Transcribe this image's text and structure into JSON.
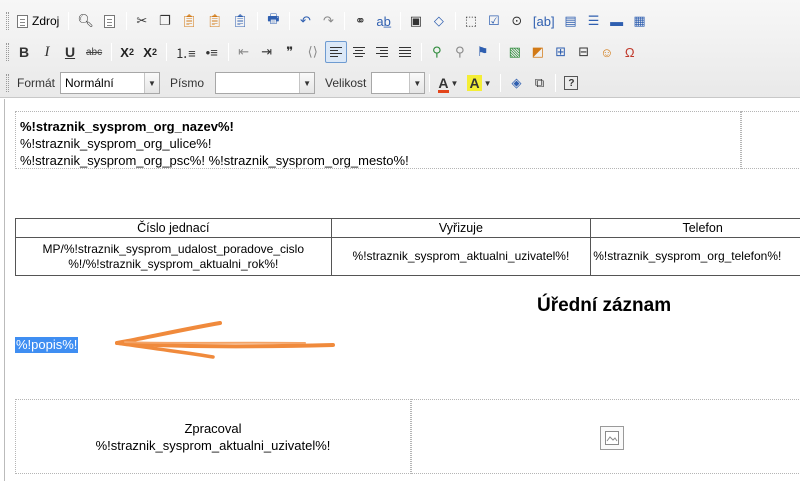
{
  "toolbar": {
    "source_label": "Zdroj",
    "format_label": "Formát",
    "format_value": "Normální",
    "font_label": "Písmo",
    "font_value": "",
    "size_label": "Velikost",
    "size_value": "",
    "bold": "B",
    "italic": "I",
    "underline": "U",
    "strike": "abc",
    "subscript_base": "X",
    "subscript_mark": "2",
    "superscript_base": "X",
    "superscript_mark": "2",
    "text_color": "A",
    "bg_color": "A",
    "help": "?",
    "blockquote": "❞",
    "accent_color": "#3f8ef2"
  },
  "document": {
    "org_name": "%!straznik_sysprom_org_nazev%!",
    "org_street": "%!straznik_sysprom_org_ulice%!",
    "org_city": "%!straznik_sysprom_org_psc%! %!straznik_sysprom_org_mesto%!",
    "table": {
      "headers": [
        "Číslo jednací",
        "Vyřizuje",
        "Telefon"
      ],
      "row": {
        "cislo_line1": "MP/%!straznik_sysprom_udalost_poradove_cislo",
        "cislo_line2": "%!/%!straznik_sysprom_aktualni_rok%!",
        "vyrizuje": "%!straznik_sysprom_aktualni_uzivatel%!",
        "telefon": "%!straznik_sysprom_org_telefon%!"
      }
    },
    "heading": "Úřední záznam",
    "popis": "%!popis%!",
    "footer_label": "Zpracoval",
    "footer_value": "%!straznik_sysprom_aktualni_uzivatel%!"
  }
}
